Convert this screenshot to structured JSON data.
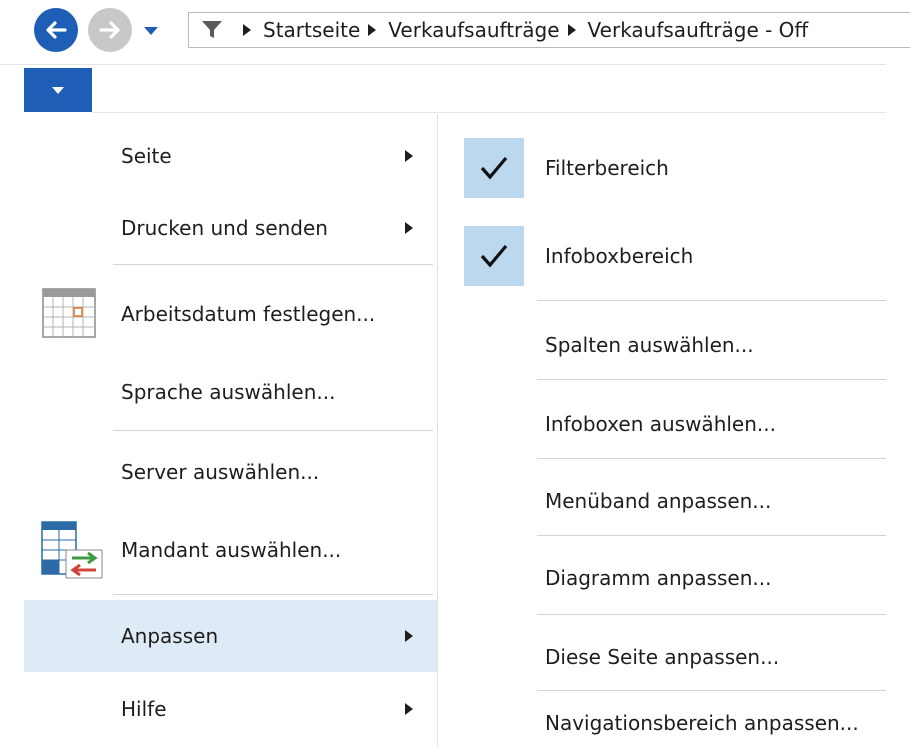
{
  "nav": {
    "back_icon": "arrow-left-icon",
    "forward_icon": "arrow-right-icon",
    "history_icon": "chevron-down-icon",
    "accent_color": "#1e5eb6"
  },
  "address": {
    "filter_icon": "filter-icon",
    "crumbs": [
      "Startseite",
      "Verkaufsaufträge",
      "Verkaufsaufträge - Off"
    ]
  },
  "app_menu": {
    "icon": "chevron-down-icon"
  },
  "left_menu": {
    "items": [
      {
        "label": "Seite",
        "submenu": true
      },
      {
        "label": "Drucken und senden",
        "submenu": true
      },
      {
        "label": "Arbeitsdatum festlegen...",
        "icon": "calendar-icon"
      },
      {
        "label": "Sprache auswählen..."
      },
      {
        "label": "Server auswählen..."
      },
      {
        "label": "Mandant auswählen...",
        "icon": "company-switch-icon"
      },
      {
        "label": "Anpassen",
        "submenu": true,
        "active": true
      },
      {
        "label": "Hilfe",
        "submenu": true
      }
    ],
    "highlight_color": "#deebf6"
  },
  "sub_menu": {
    "items": [
      {
        "label": "Filterbereich",
        "checked": true
      },
      {
        "label": "Infoboxbereich",
        "checked": true
      },
      {
        "label": "Spalten auswählen..."
      },
      {
        "label": "Infoboxen auswählen..."
      },
      {
        "label": "Menüband anpassen..."
      },
      {
        "label": "Diagramm anpassen..."
      },
      {
        "label": "Diese Seite anpassen..."
      },
      {
        "label": "Navigationsbereich anpassen..."
      }
    ],
    "check_color": "#bcd8ef"
  }
}
